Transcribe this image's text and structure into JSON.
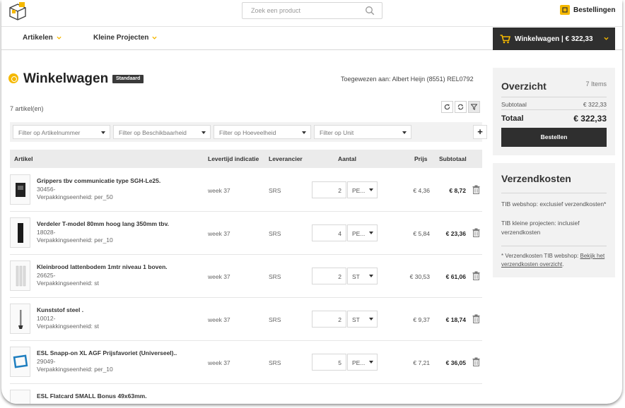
{
  "header": {
    "search_placeholder": "Zoek een product",
    "orders_label": "Bestellingen"
  },
  "nav": {
    "items": [
      {
        "label": "Artikelen"
      },
      {
        "label": "Kleine Projecten"
      }
    ],
    "cart_label": "Winkelwagen | € 322,33"
  },
  "page": {
    "title": "Winkelwagen",
    "badge": "Standaard",
    "assigned": "Toegewezen aan: Albert Heijn (8551) REL0792",
    "count": "7 artikel(en)"
  },
  "filters": [
    "Filter op Artikelnummer",
    "Filter op Beschikbaarheid",
    "Filter op Hoeveelheid",
    "Filter op Unit"
  ],
  "table": {
    "headers": {
      "article": "Artikel",
      "lead": "Levertijd indicatie",
      "supplier": "Leverancier",
      "qty": "Aantal",
      "price": "Prijs",
      "subtotal": "Subtotaal"
    },
    "rows": [
      {
        "name": "Grippers tbv communicatie type SGH-Le25.",
        "code": "30456-",
        "pack": "Verpakkingseenheid: per_50",
        "week": "week 37",
        "supplier": "SRS",
        "qty": "2",
        "unit": "PE...",
        "price": "€ 4,36",
        "subtotal": "€ 8,72"
      },
      {
        "name": "Verdeler T-model 80mm hoog lang 350mm tbv.",
        "code": "18028-",
        "pack": "Verpakkingseenheid: per_10",
        "week": "week 37",
        "supplier": "SRS",
        "qty": "4",
        "unit": "PE...",
        "price": "€ 5,84",
        "subtotal": "€ 23,36"
      },
      {
        "name": "Kleinbrood lattenbodem 1mtr niveau 1 boven.",
        "code": "26625-",
        "pack": "Verpakkingseenheid: st",
        "week": "week 37",
        "supplier": "SRS",
        "qty": "2",
        "unit": "ST",
        "price": "€ 30,53",
        "subtotal": "€ 61,06"
      },
      {
        "name": "Kunststof steel .",
        "code": "10012-",
        "pack": "Verpakkingseenheid: st",
        "week": "week 37",
        "supplier": "SRS",
        "qty": "2",
        "unit": "ST",
        "price": "€ 9,37",
        "subtotal": "€ 18,74"
      },
      {
        "name": "ESL Snapp-on XL AGF Prijsfavoriet (Universeel)..",
        "code": "29049-",
        "pack": "Verpakkingseenheid: per_10",
        "week": "week 37",
        "supplier": "SRS",
        "qty": "5",
        "unit": "PE...",
        "price": "€ 7,21",
        "subtotal": "€ 36,05"
      },
      {
        "name": "ESL Flatcard SMALL Bonus 49x63mm.",
        "code": "",
        "pack": "",
        "week": "",
        "supplier": "",
        "qty": "",
        "unit": "",
        "price": "",
        "subtotal": ""
      }
    ]
  },
  "overview": {
    "title": "Overzicht",
    "items": "7 Items",
    "subtotal_label": "Subtotaal",
    "subtotal_value": "€ 322,33",
    "total_label": "Totaal",
    "total_value": "€ 322,33",
    "order_button": "Bestellen"
  },
  "shipping": {
    "title": "Verzendkosten",
    "line1": "TIB webshop: exclusief verzendkosten*",
    "line2": "TIB kleine projecten: inclusief verzendkosten",
    "note": "* Verzendkosten TIB webshop: ",
    "link": "Bekijk het verzendkosten overzicht",
    "note_end": "."
  }
}
